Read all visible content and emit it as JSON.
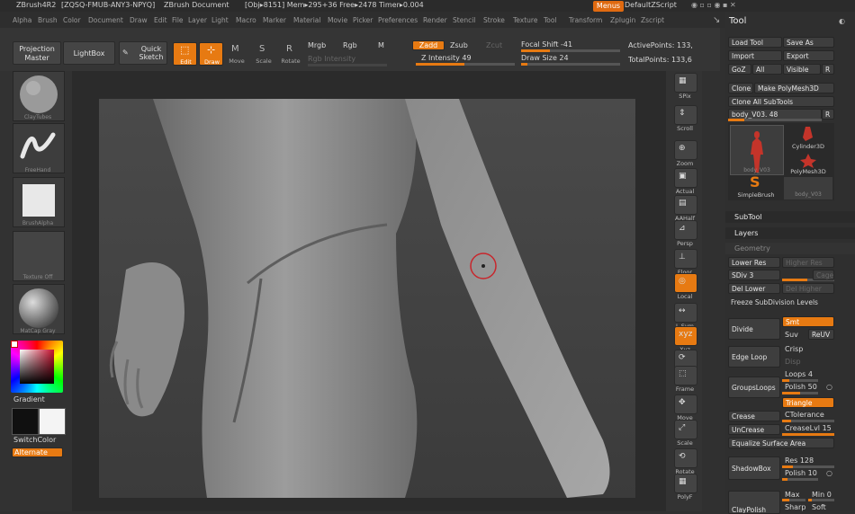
{
  "title_bar": {
    "app": "ZBrush4R2",
    "serial": "[ZQSQ-FMUB-ANY3-NPYQ]",
    "document": "ZBrush Document",
    "stats": "[Obj▸8151] Mem▸295+36 Free▸2478 Timer▸0.004",
    "menus_button": "Menus",
    "script": "DefaultZScript"
  },
  "menu_items": [
    "Alpha",
    "Brush",
    "Color",
    "Document",
    "Draw",
    "Edit",
    "File",
    "Layer",
    "Light",
    "Macro",
    "Marker",
    "Material",
    "Movie",
    "Picker",
    "Preferences",
    "Render",
    "Stencil",
    "Stroke",
    "Texture",
    "Tool",
    "Transform",
    "Zplugin",
    "Zscript"
  ],
  "shelf": {
    "projection_master": "Projection Master",
    "lightbox": "LightBox",
    "quick_sketch": "Quick Sketch",
    "edit": "Edit",
    "draw": "Draw",
    "move": "Move",
    "scale": "Scale",
    "rotate": "Rotate",
    "mrgb": "Mrgb",
    "rgb": "Rgb",
    "m": "M",
    "rgb_intensity": "Rgb Intensity",
    "zadd": "Zadd",
    "zsub": "Zsub",
    "zcut": "Zcut",
    "z_intensity": "Z Intensity 49",
    "z_intensity_value": 49,
    "focal_shift": "Focal Shift -41",
    "focal_shift_value": -41,
    "draw_size": "Draw Size 24",
    "draw_size_value": 24,
    "active_points": "ActivePoints: 133,",
    "total_points": "TotalPoints: 133,6"
  },
  "left_panel": {
    "brush_label": "ClayTubes",
    "stroke_label": "FreeHand",
    "alpha_label": "BrushAlpha",
    "texture_label": "Texture Off",
    "material_label": "MatCap Gray",
    "gradient": "Gradient",
    "switch_color": "SwitchColor",
    "alternate": "Alternate"
  },
  "right_shelf": [
    "SPix",
    "Scroll",
    "Zoom",
    "Actual",
    "AAHalf",
    "Persp",
    "Floor",
    "Local",
    "L.Sym",
    "Xyz",
    "",
    "Frame",
    "Move",
    "Scale",
    "Rotate",
    "PolyF"
  ],
  "tool_panel": {
    "title": "Tool",
    "load_tool": "Load Tool",
    "save_as": "Save As",
    "import": "Import",
    "export": "Export",
    "goz": "GoZ",
    "all": "All",
    "visible": "Visible",
    "r": "R",
    "clone": "Clone",
    "make_polymesh": "Make PolyMesh3D",
    "clone_all": "Clone All SubTools",
    "current_tool": "body_V03. 48",
    "tools": [
      "body_V03",
      "Cylinder3D",
      "PolyMesh3D",
      "SimpleBrush",
      "body_V03"
    ],
    "subtool": "SubTool",
    "layers": "Layers",
    "geometry": "Geometry",
    "lower_res": "Lower Res",
    "higher_res": "Higher Res",
    "sdiv": "SDiv 3",
    "cage": "Cage",
    "del_lower": "Del Lower",
    "del_higher": "Del Higher",
    "freeze": "Freeze SubDivision Levels",
    "divide": "Divide",
    "smt": "Smt",
    "suv": "Suv",
    "reuv": "ReUV",
    "edge_loop": "Edge Loop",
    "crisp": "Crisp",
    "disp": "Disp",
    "groups_loops": "GroupsLoops",
    "loops": "Loops 4",
    "polish": "Polish 50",
    "triangle": "Triangle",
    "crease": "Crease",
    "ctolerance": "CTolerance",
    "uncrease": "UnCrease",
    "creaselvl": "CreaseLvl 15",
    "equalize": "Equalize Surface Area",
    "shadowbox": "ShadowBox",
    "res": "Res 128",
    "polish2": "Polish 10",
    "claypolish": "ClayPolish",
    "max": "Max",
    "min": "Min 0",
    "sharp": "Sharp",
    "soft": "Soft"
  },
  "colors": {
    "accent": "#e77a12",
    "panel": "#303030",
    "viewport": "#444444"
  }
}
